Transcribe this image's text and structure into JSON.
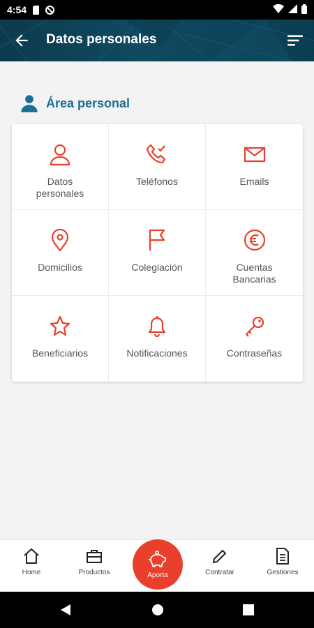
{
  "status_bar": {
    "time": "4:54"
  },
  "app_bar": {
    "title": "Datos personales"
  },
  "section": {
    "title": "Área personal"
  },
  "tiles": [
    {
      "label": "Datos\npersonales",
      "icon": "user-icon"
    },
    {
      "label": "Teléfonos",
      "icon": "phone-icon"
    },
    {
      "label": "Emails",
      "icon": "envelope-icon"
    },
    {
      "label": "Domicilios",
      "icon": "location-pin-icon"
    },
    {
      "label": "Colegiación",
      "icon": "flag-icon"
    },
    {
      "label": "Cuentas\nBancarias",
      "icon": "euro-icon"
    },
    {
      "label": "Beneficiarios",
      "icon": "star-icon"
    },
    {
      "label": "Notificaciones",
      "icon": "bell-icon"
    },
    {
      "label": "Contraseñas",
      "icon": "key-icon"
    }
  ],
  "bottom_nav": {
    "home": "Home",
    "productos": "Productos",
    "aporta": "Aporta",
    "contratar": "Contratar",
    "gestiones": "Gestiones"
  },
  "colors": {
    "accent": "#e8402c",
    "primary": "#1c6e95",
    "app_bar": "#0f4a60"
  }
}
